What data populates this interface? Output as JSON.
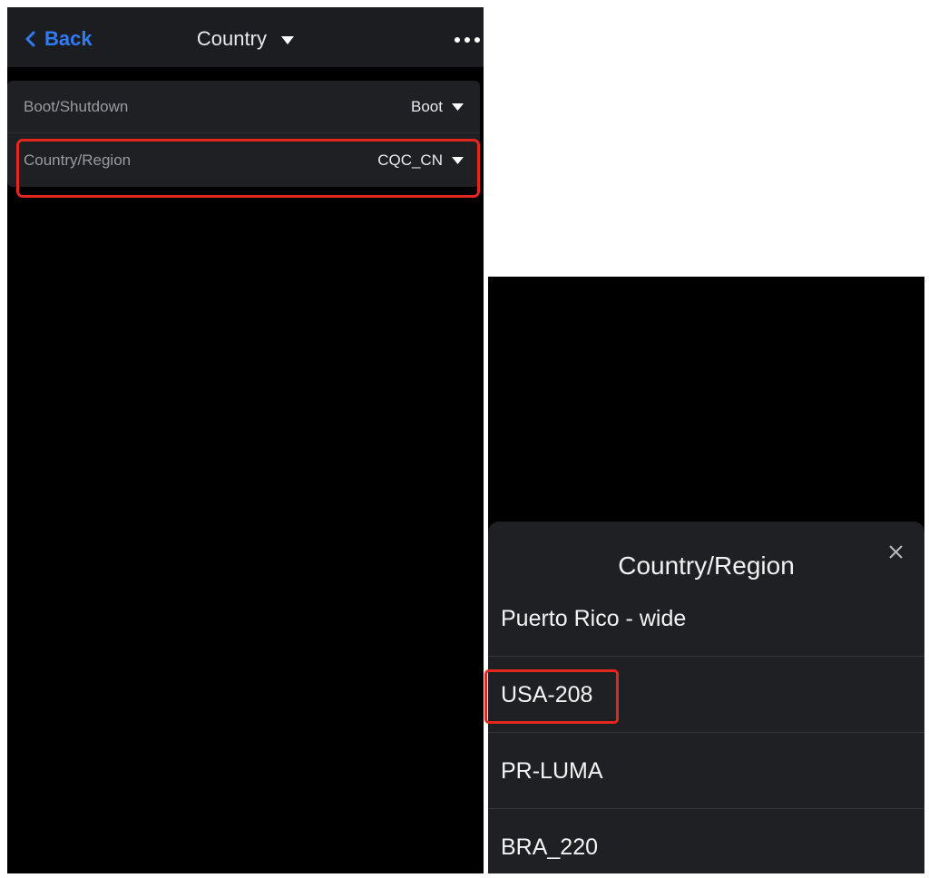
{
  "left_screen": {
    "navbar": {
      "back_label": "Back",
      "title": "Country",
      "title_icon": "caret-down-icon",
      "more_icon": "more-horizontal-icon"
    },
    "settings": [
      {
        "label": "Boot/Shutdown",
        "value": "Boot"
      },
      {
        "label": "Country/Region",
        "value": "CQC_CN"
      }
    ]
  },
  "right_screen": {
    "sheet": {
      "title": "Country/Region",
      "close_icon": "close-icon",
      "options": [
        "Puerto Rico - wide",
        "USA-208",
        "PR-LUMA",
        "BRA_220"
      ]
    }
  },
  "colors": {
    "accent": "#2f7cf6",
    "highlight": "#e3261e",
    "background": "#000000",
    "surface": "#1f2023"
  }
}
